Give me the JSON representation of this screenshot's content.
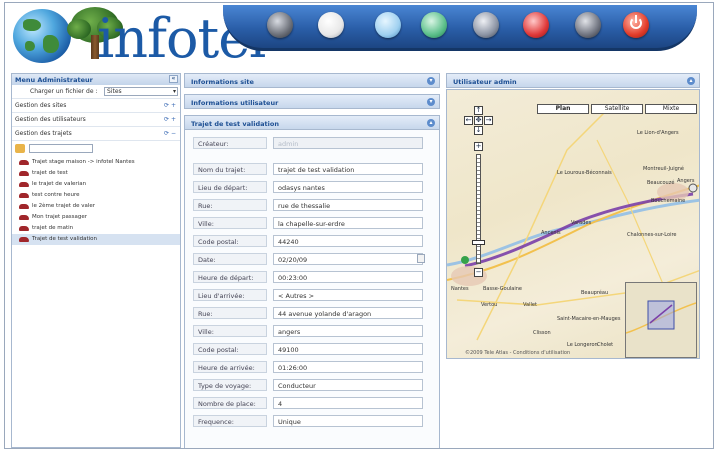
{
  "header": {
    "logo_text": "infotel",
    "toolbar_icons": [
      {
        "name": "icon-1",
        "color": "#6b6f78"
      },
      {
        "name": "icon-2",
        "color": "#e8e8e8"
      },
      {
        "name": "icon-3",
        "color": "#9fd0f0"
      },
      {
        "name": "icon-4",
        "color": "#5bbf8a"
      },
      {
        "name": "icon-5",
        "color": "#8c94a4"
      },
      {
        "name": "icon-6",
        "color": "#e03838"
      },
      {
        "name": "icon-7",
        "color": "#707480"
      },
      {
        "name": "power-icon",
        "color": "#e23c2a"
      }
    ]
  },
  "left_panel": {
    "title": "Menu Administrateur",
    "load_label": "Charger un fichier de :",
    "load_select": "Sites",
    "sections": [
      "Gestion des sites",
      "Gestion des utilisateurs",
      "Gestion des trajets"
    ],
    "trips": [
      "Trajet stage maison -> infotel Nantes",
      "trajet de test",
      "le trajet de valerian",
      "test contre heure",
      "le 2ème trajet de valer",
      "Mon trajet passager",
      "trajet de matin",
      "Trajet de test validation"
    ]
  },
  "middle_panel": {
    "acc_site": "Informations site",
    "acc_user": "Informations utilisateur",
    "acc_trip": "Trajet de test validation",
    "creator_label": "Créateur:",
    "creator_value": "admin",
    "fields": [
      {
        "label": "Nom du trajet:",
        "value": "trajet de test validation"
      },
      {
        "label": "Lieu de départ:",
        "value": "odasys nantes"
      },
      {
        "label": "Rue:",
        "value": "rue de thessalie"
      },
      {
        "label": "Ville:",
        "value": "la chapelle-sur-erdre"
      },
      {
        "label": "Code postal:",
        "value": "44240"
      },
      {
        "label": "Date:",
        "value": "02/20/09"
      },
      {
        "label": "Heure de départ:",
        "value": "00:23:00"
      },
      {
        "label": "Lieu d'arrivée:",
        "value": "< Autres >"
      },
      {
        "label": "Rue:",
        "value": "44 avenue yolande d'aragon"
      },
      {
        "label": "Ville:",
        "value": "angers"
      },
      {
        "label": "Code postal:",
        "value": "49100"
      },
      {
        "label": "Heure de arrivée:",
        "value": "01:26:00"
      },
      {
        "label": "Type de voyage:",
        "value": "Conducteur"
      },
      {
        "label": "Nombre de place:",
        "value": "4"
      },
      {
        "label": "Frequence:",
        "value": "Unique"
      }
    ]
  },
  "right_panel": {
    "title": "Utilisateur admin",
    "map_types": [
      "Plan",
      "Satellite",
      "Mixte"
    ],
    "towns": [
      "Le Lion-d'Angers",
      "Le Louroux-Béconnais",
      "Montreuil-Juigné",
      "Beaucouzé",
      "Angers",
      "Bouchemaine",
      "Ancenis",
      "Varades",
      "Chalonnes-sur-Loire",
      "Nantes",
      "Basse-Goulaine",
      "Vertou",
      "Vallet",
      "Beaupréau",
      "Saint-Macaire-en-Mauges",
      "Clisson",
      "Cholet",
      "Le Longeron"
    ],
    "map_copyright": "©2009 Tele Atlas - Conditions d'utilisation",
    "route_color": "#7a3fa8"
  }
}
